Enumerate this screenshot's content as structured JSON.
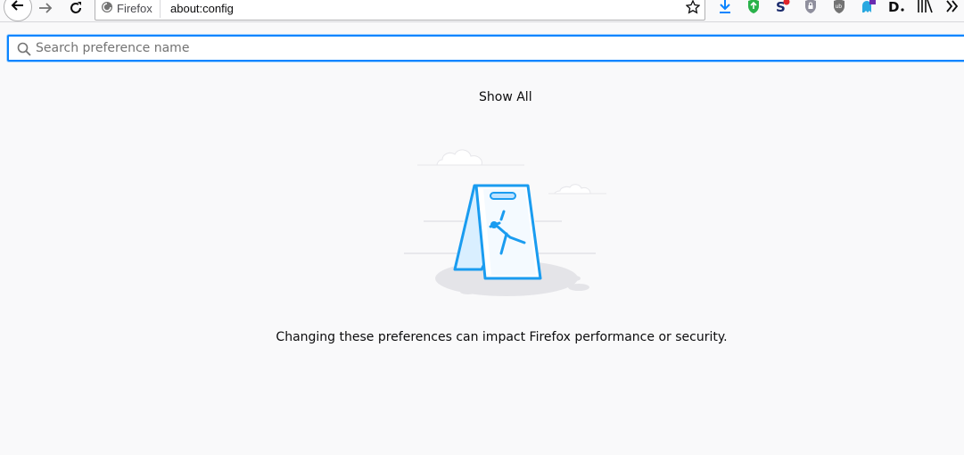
{
  "browser": {
    "identity_label": "Firefox",
    "url": "about:config"
  },
  "toolbar_icons": [
    "back-icon",
    "forward-icon",
    "reload-icon",
    "bookmark-star-icon",
    "download-icon",
    "shield-extension-icon",
    "s-extension-icon",
    "lock-extension-icon",
    "ublock-extension-icon",
    "ghost-extension-icon",
    "d-extension-icon",
    "library-icon",
    "overflow-icon"
  ],
  "search": {
    "placeholder": "Search preference name"
  },
  "show_all_label": "Show All",
  "warning_text": "Changing these preferences can impact Firefox performance or security.",
  "colors": {
    "accent": "#0a84ff",
    "illustration_blue": "#1a9cf0",
    "background": "#f9f9fa"
  }
}
